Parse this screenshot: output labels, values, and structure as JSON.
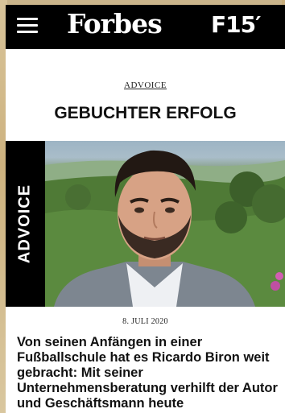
{
  "header": {
    "logo": "Forbes",
    "edition": "F15′"
  },
  "article": {
    "kicker": "ADVOICE",
    "headline": "GEBUCHTER ERFOLG",
    "image_tab": "ADVOICE",
    "date": "8. JULI 2020",
    "teaser": "Von seinen Anfängen in einer Fußballschule hat es Ricardo Biron weit gebracht: Mit seiner Unternehmensberatung verhilft der Autor und Geschäftsmann heute"
  },
  "colors": {
    "header_bg": "#000000",
    "page_bg": "#ffffff",
    "text": "#111111"
  },
  "icons": [
    "menu-icon"
  ]
}
